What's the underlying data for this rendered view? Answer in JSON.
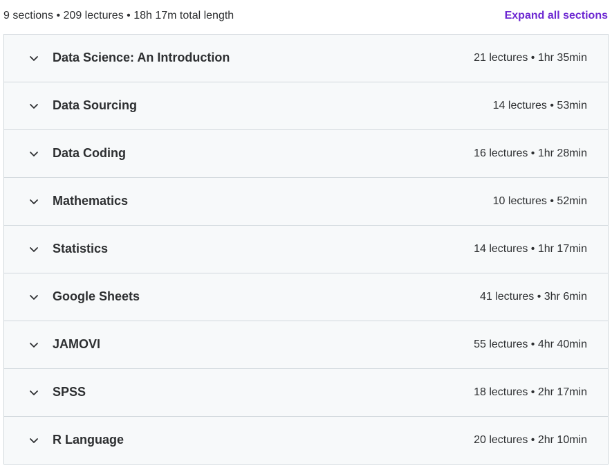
{
  "summary": {
    "text": "9 sections • 209 lectures • 18h 17m total length",
    "expand_all_label": "Expand all sections"
  },
  "colors": {
    "accent": "#6d28d2",
    "row_background": "#f7f9fa",
    "border": "#d1d7dc",
    "text": "#2d2f31"
  },
  "sections": [
    {
      "title": "Data Science: An Introduction",
      "meta": "21 lectures • 1hr 35min",
      "icon": "chevron-down-icon"
    },
    {
      "title": "Data Sourcing",
      "meta": "14 lectures • 53min",
      "icon": "chevron-down-icon"
    },
    {
      "title": "Data Coding",
      "meta": "16 lectures • 1hr 28min",
      "icon": "chevron-down-icon"
    },
    {
      "title": "Mathematics",
      "meta": "10 lectures • 52min",
      "icon": "chevron-down-icon"
    },
    {
      "title": "Statistics",
      "meta": "14 lectures • 1hr 17min",
      "icon": "chevron-down-icon"
    },
    {
      "title": "Google Sheets",
      "meta": "41 lectures • 3hr 6min",
      "icon": "chevron-down-icon"
    },
    {
      "title": "JAMOVI",
      "meta": "55 lectures • 4hr 40min",
      "icon": "chevron-down-icon"
    },
    {
      "title": "SPSS",
      "meta": "18 lectures • 2hr 17min",
      "icon": "chevron-down-icon"
    },
    {
      "title": "R Language",
      "meta": "20 lectures • 2hr 10min",
      "icon": "chevron-down-icon"
    }
  ]
}
